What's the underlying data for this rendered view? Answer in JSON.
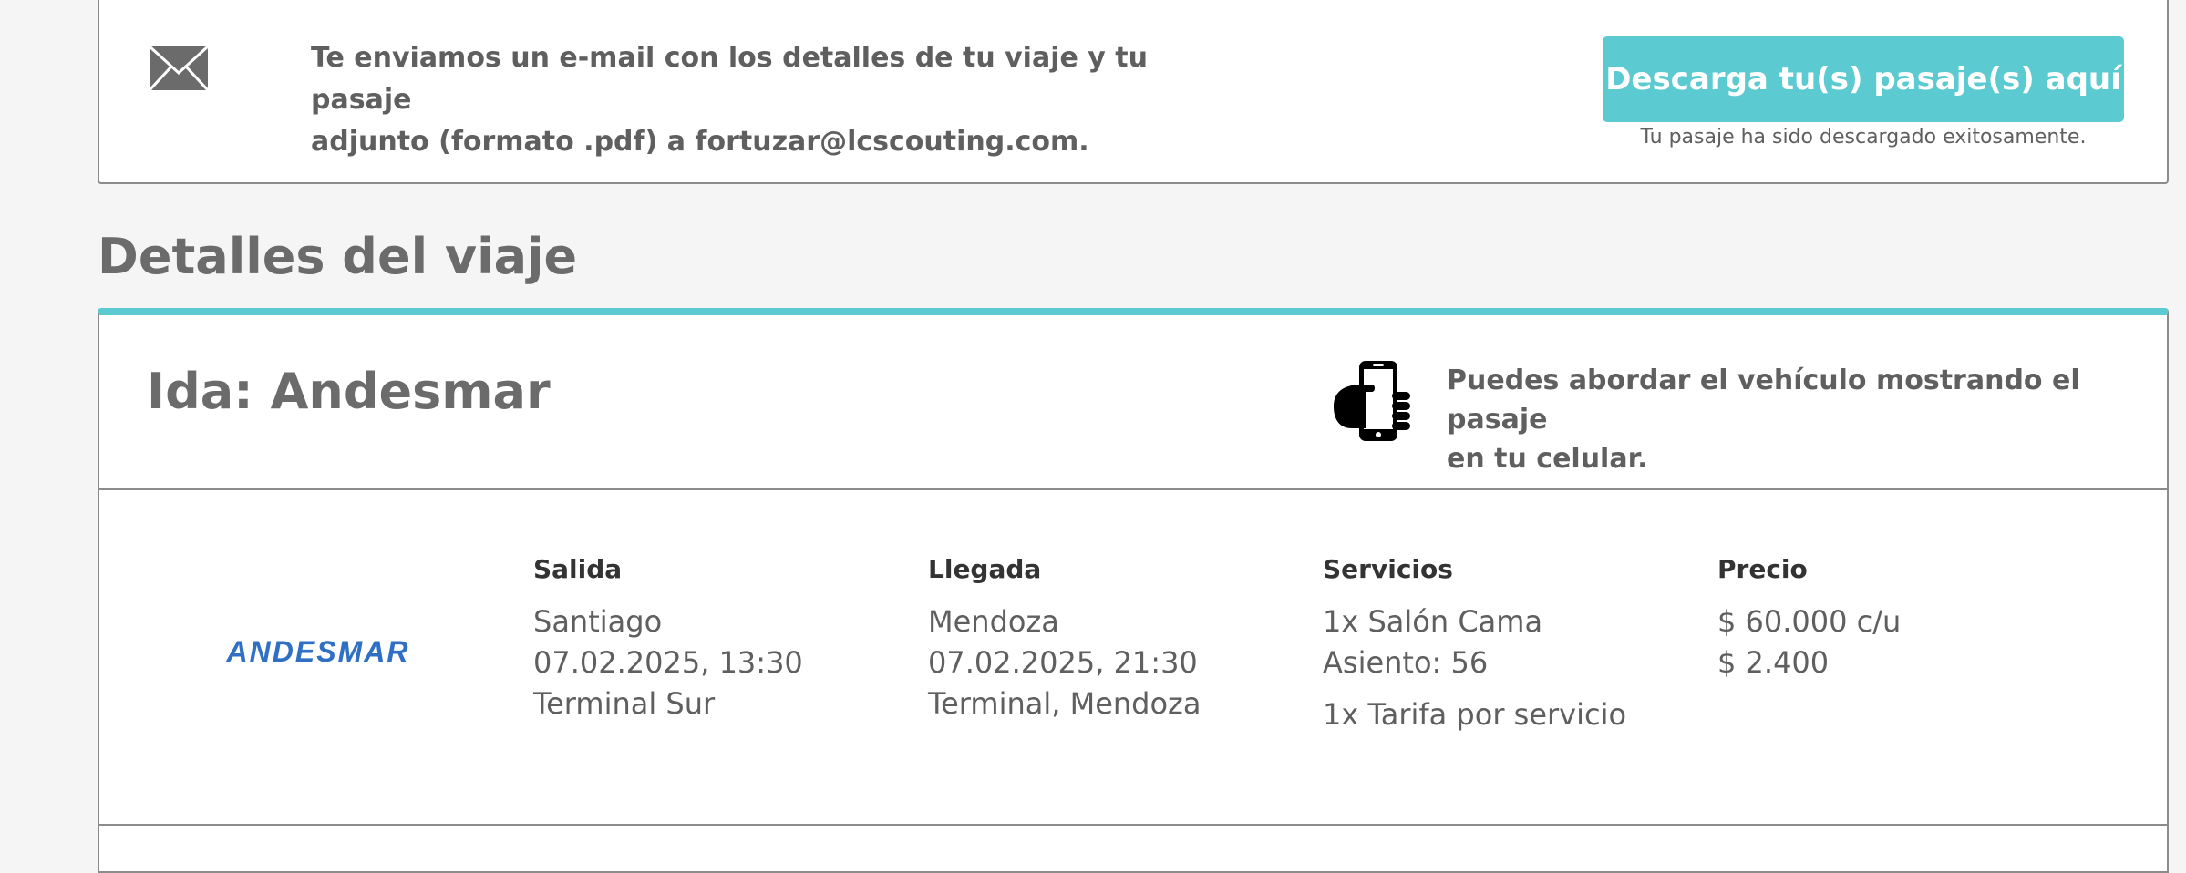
{
  "email_notice": {
    "icon": "envelope-icon",
    "line1": "Te enviamos un e-mail con los detalles de tu viaje y tu pasaje",
    "line2": "adjunto (formato .pdf) a fortuzar@lcscouting.com.",
    "download_button_label": "Descarga tu(s) pasaje(s) aquí",
    "download_status": "Tu pasaje ha sido descargado exitosamente."
  },
  "section_title": "Detalles del viaje",
  "trip": {
    "title": "Ida: Andesmar",
    "mobile_icon": "mobile-phone-hand-icon",
    "mobile_note_line1": "Puedes abordar el vehículo mostrando el pasaje",
    "mobile_note_line2": "en tu celular.",
    "company_logo": "ANDESMAR",
    "departure": {
      "label": "Salida",
      "city": "Santiago",
      "datetime": "07.02.2025, 13:30",
      "terminal": "Terminal Sur"
    },
    "arrival": {
      "label": "Llegada",
      "city": "Mendoza",
      "datetime": "07.02.2025, 21:30",
      "terminal": "Terminal, Mendoza"
    },
    "services": {
      "label": "Servicios",
      "items": [
        "1x Salón Cama",
        "Asiento: 56",
        "1x Tarifa por servicio"
      ]
    },
    "price": {
      "label": "Precio",
      "items": [
        "$ 60.000 c/u",
        "$ 2.400"
      ]
    }
  },
  "colors": {
    "accent": "#5bcbd1",
    "text": "#6b6b6b",
    "logo_blue": "#2f6fc4"
  }
}
